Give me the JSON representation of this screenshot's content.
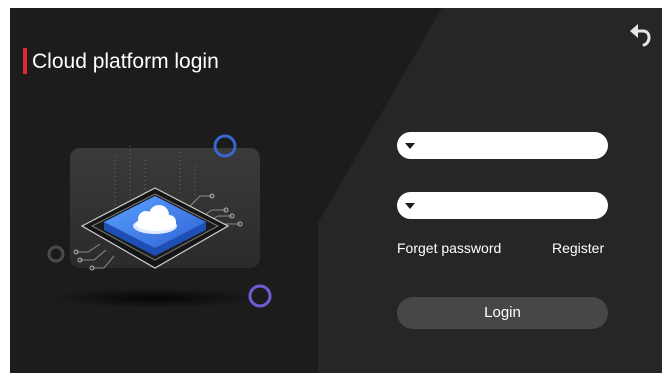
{
  "login": {
    "title": "Cloud platform login",
    "account_placeholder": "",
    "password_placeholder": "",
    "forget_password": "Forget password",
    "register": "Register",
    "login_button": "Login"
  },
  "icons": {
    "back": "back-arrow-icon",
    "account_dropdown": "caret-down-icon",
    "password_dropdown": "caret-down-icon",
    "cloud": "cloud-icon"
  },
  "colors": {
    "background": "#1c1c1c",
    "panel": "#262626",
    "accent": "#e3262f",
    "chip": "#3f7ff0",
    "ring_blue": "#3a66d4",
    "ring_purple": "#6a5ed4"
  }
}
